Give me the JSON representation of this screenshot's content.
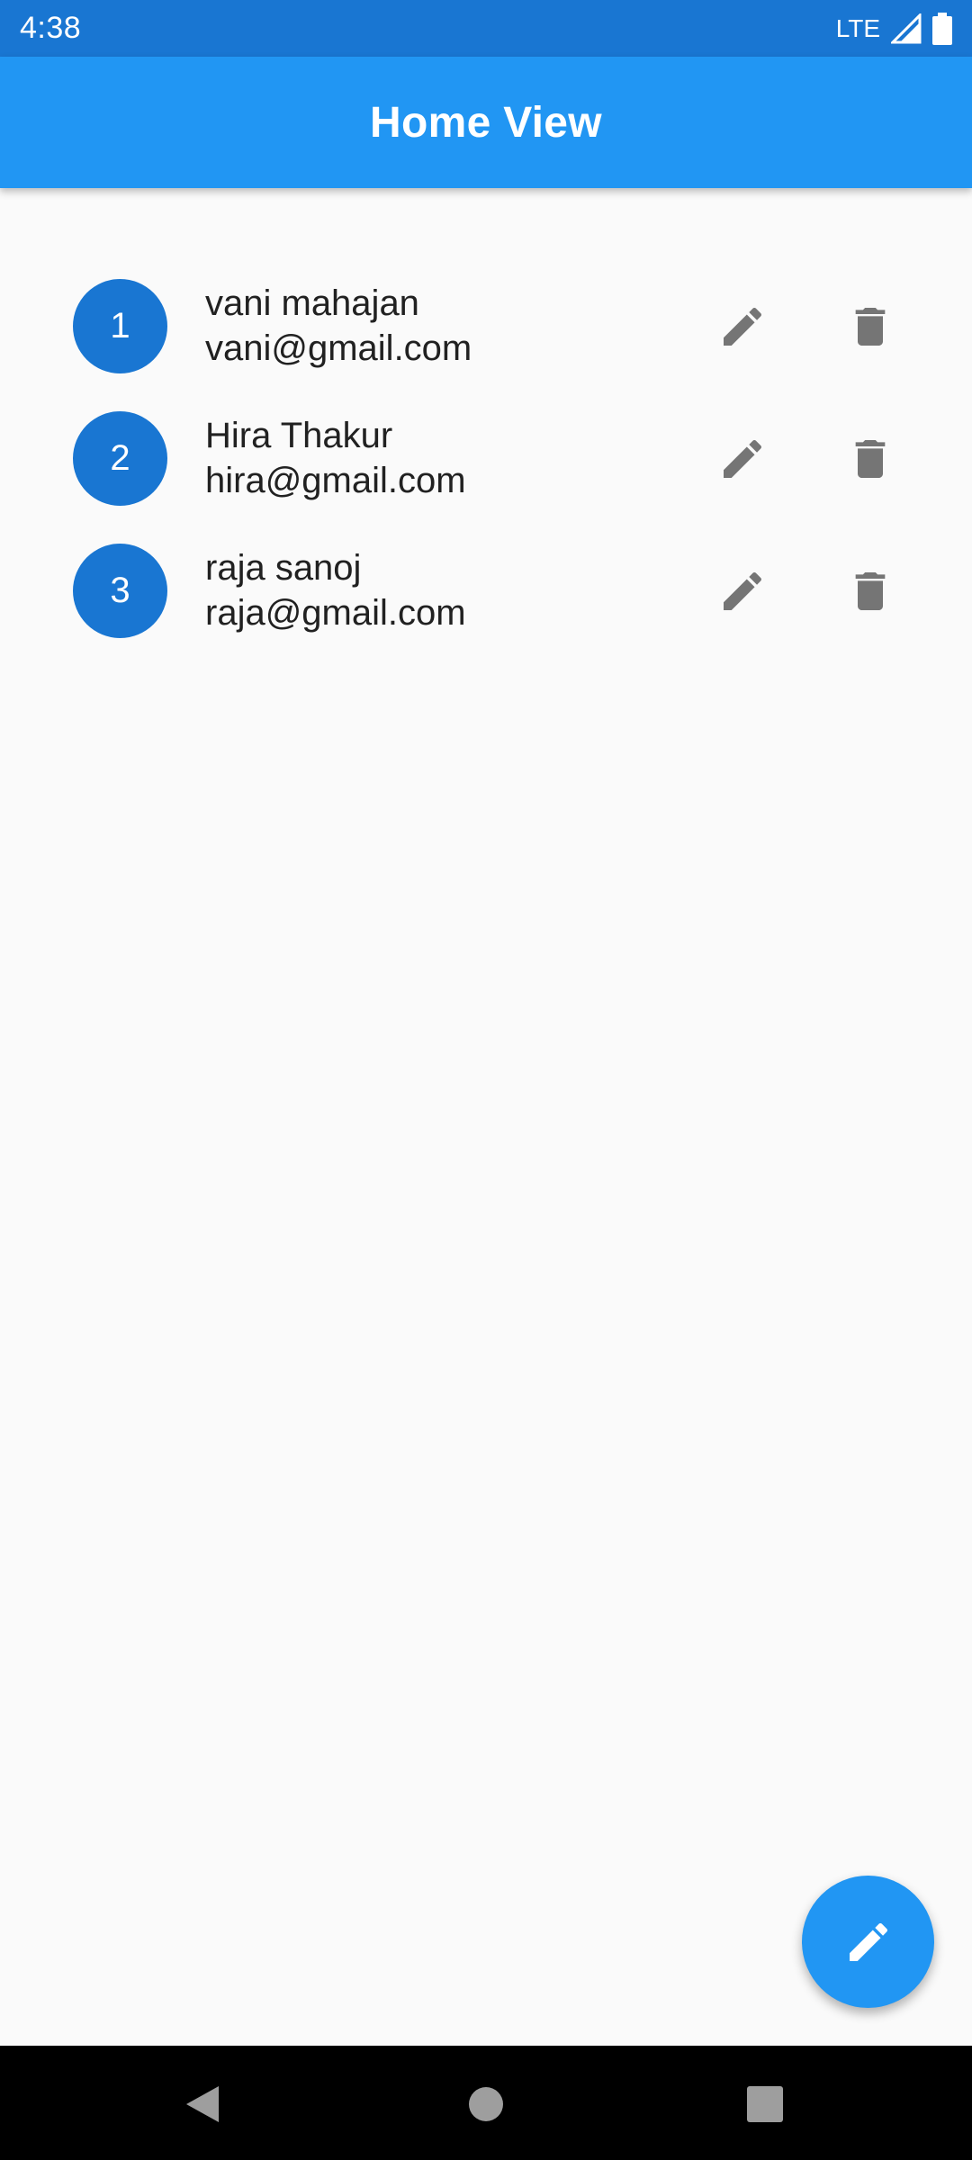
{
  "status_bar": {
    "time": "4:38",
    "network": "LTE",
    "icons": [
      "signal-icon",
      "battery-icon"
    ]
  },
  "app_bar": {
    "title": "Home View",
    "color": "#2196f3"
  },
  "users": [
    {
      "index": "1",
      "name": "vani mahajan",
      "email": "vani@gmail.com"
    },
    {
      "index": "2",
      "name": "Hira Thakur",
      "email": "hira@gmail.com"
    },
    {
      "index": "3",
      "name": "raja sanoj",
      "email": "raja@gmail.com"
    }
  ],
  "row_icons": {
    "edit": "pencil-icon",
    "delete": "trash-icon"
  },
  "fab": {
    "icon": "pencil-icon"
  },
  "nav_bar": {
    "icons": [
      "back-icon",
      "home-icon",
      "recents-icon"
    ]
  },
  "colors": {
    "primary": "#2196f3",
    "primary_dark": "#1976d2",
    "icon_gray": "#757575",
    "background": "#fafafa"
  }
}
